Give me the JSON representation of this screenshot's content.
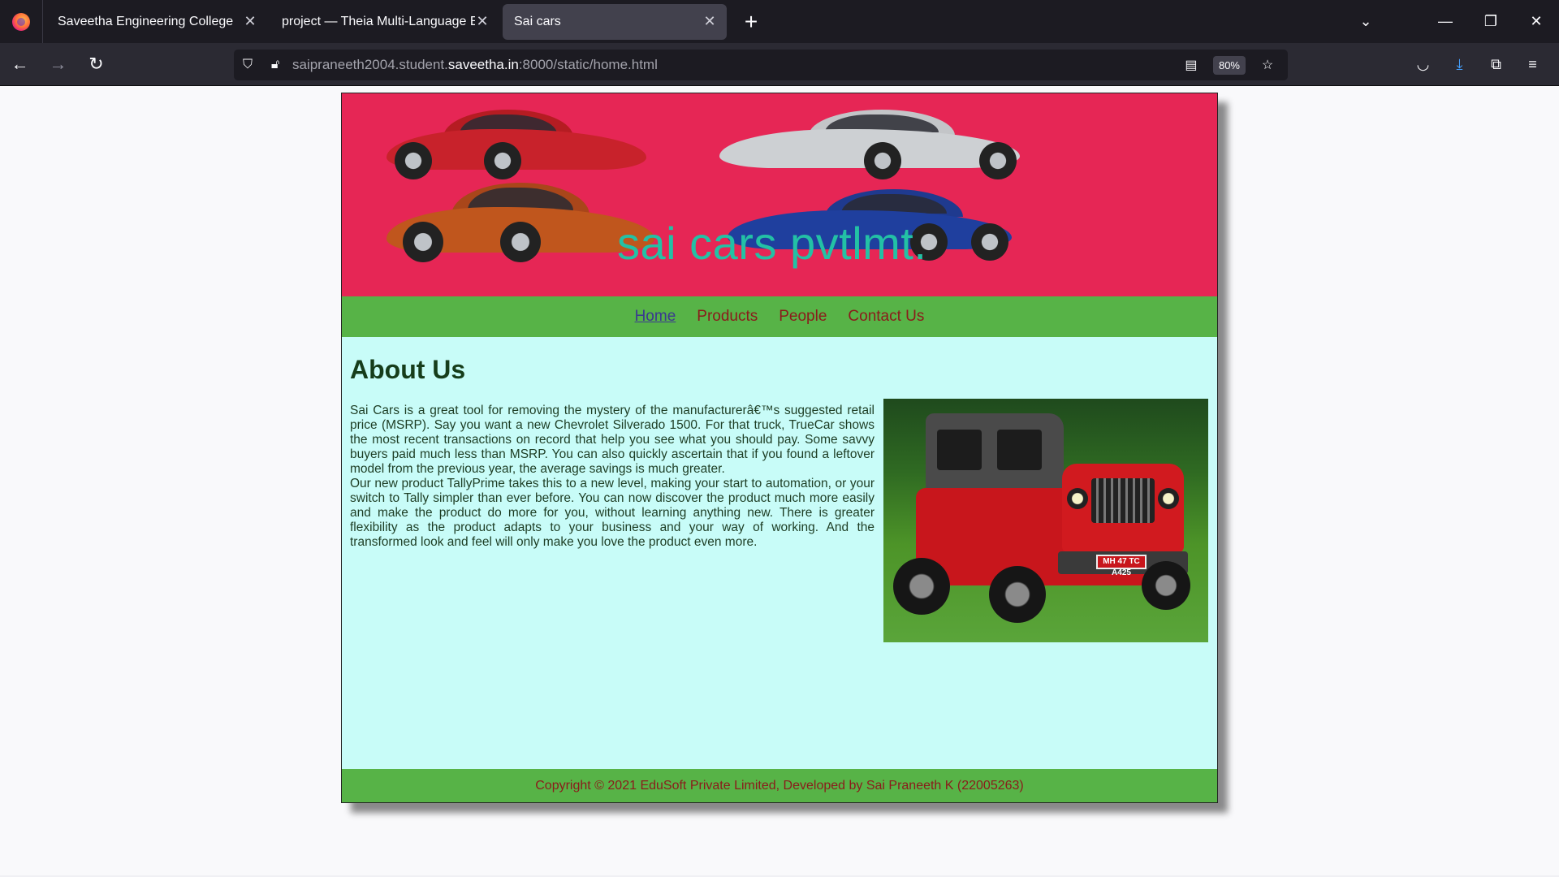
{
  "browser": {
    "tabs": [
      {
        "title": "Saveetha Engineering College",
        "active": false
      },
      {
        "title": "project — Theia Multi-Language Ex",
        "active": false
      },
      {
        "title": "Sai cars",
        "active": true
      }
    ],
    "url": {
      "prefix": "saipraneeth2004.student.",
      "host": "saveetha.in",
      "suffix": ":8000/static/home.html"
    },
    "zoom": "80%",
    "icons": {
      "new_tab": "plus-icon",
      "list_all_tabs": "chevron-down-icon",
      "minimize": "minimize-icon",
      "restore": "restore-icon",
      "close_window": "close-icon",
      "back": "back-arrow-icon",
      "forward": "forward-arrow-icon",
      "reload": "reload-icon",
      "shield": "shield-icon",
      "lock": "lock-icon",
      "reader": "reader-view-icon",
      "bookmark": "star-icon",
      "pocket": "pocket-icon",
      "downloads": "download-icon",
      "extensions": "puzzle-icon",
      "menu": "hamburger-menu-icon"
    }
  },
  "site": {
    "banner_title": "sai cars pvtlmt.",
    "nav": [
      {
        "label": "Home",
        "active": true
      },
      {
        "label": "Products",
        "active": false
      },
      {
        "label": "People",
        "active": false
      },
      {
        "label": "Contact Us",
        "active": false
      }
    ],
    "about_heading": "About Us",
    "paragraph_1": "Sai Cars is a great tool for removing the mystery of the manufacturerâ€™s suggested retail price (MSRP). Say you want a new Chevrolet Silverado 1500. For that truck, TrueCar shows the most recent transactions on record that help you see what you should pay. Some savvy buyers paid much less than MSRP. You can also quickly ascertain that if you found a leftover model from the previous year, the average savings is much greater.",
    "paragraph_2": "Our new product TallyPrime takes this to a new level, making your start to automation, or your switch to Tally simpler than ever before. You can now discover the product much more easily and make the product do more for you, without learning anything new. There is greater flexibility as the product adapts to your business and your way of working. And the transformed look and feel will only make you love the product even more.",
    "jeep_plate": "MH 47 TC A425",
    "footer": "Copyright © 2021 EduSoft Private Limited, Developed by Sai Praneeth K (22005263)",
    "colors": {
      "banner": "#e62655",
      "nav_and_footer": "#57b347",
      "content_bg": "#c8fcf8",
      "title_text": "#23c1a5",
      "link_text": "#8b1b1b"
    }
  }
}
